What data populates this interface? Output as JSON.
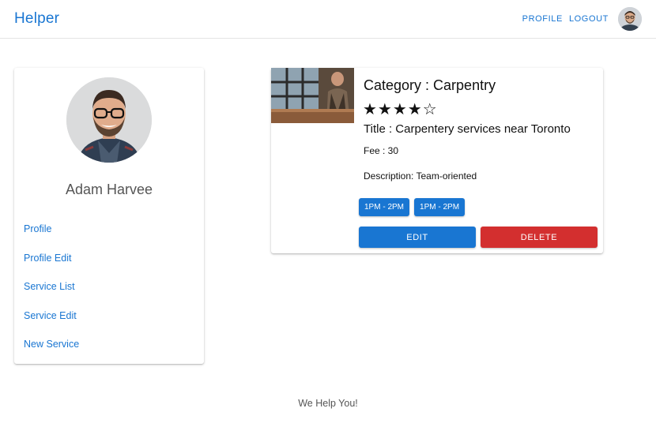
{
  "appbar": {
    "brand": "Helper",
    "links": {
      "profile": "PROFILE",
      "logout": "LOGOUT"
    }
  },
  "sidebar": {
    "name": "Adam Harvee",
    "items": [
      {
        "label": "Profile"
      },
      {
        "label": "Profile Edit"
      },
      {
        "label": "Service List"
      },
      {
        "label": "Service Edit"
      },
      {
        "label": "New Service"
      }
    ]
  },
  "service": {
    "category": "Category : Carpentry",
    "rating_stars": "★★★★☆",
    "rating_value": 4,
    "rating_max": 5,
    "title": "Title : Carpentery services near Toronto",
    "fee": "Fee : 30",
    "description": "Description: Team-oriented",
    "slots": [
      "1PM - 2PM",
      "1PM - 2PM"
    ],
    "edit_label": "EDIT",
    "delete_label": "DELETE"
  },
  "footer": {
    "text": "We Help You!"
  },
  "colors": {
    "primary": "#1976d2",
    "danger": "#d32f2f"
  },
  "icons": {
    "avatar": "user-avatar-icon",
    "service_photo": "carpenter-photo"
  }
}
